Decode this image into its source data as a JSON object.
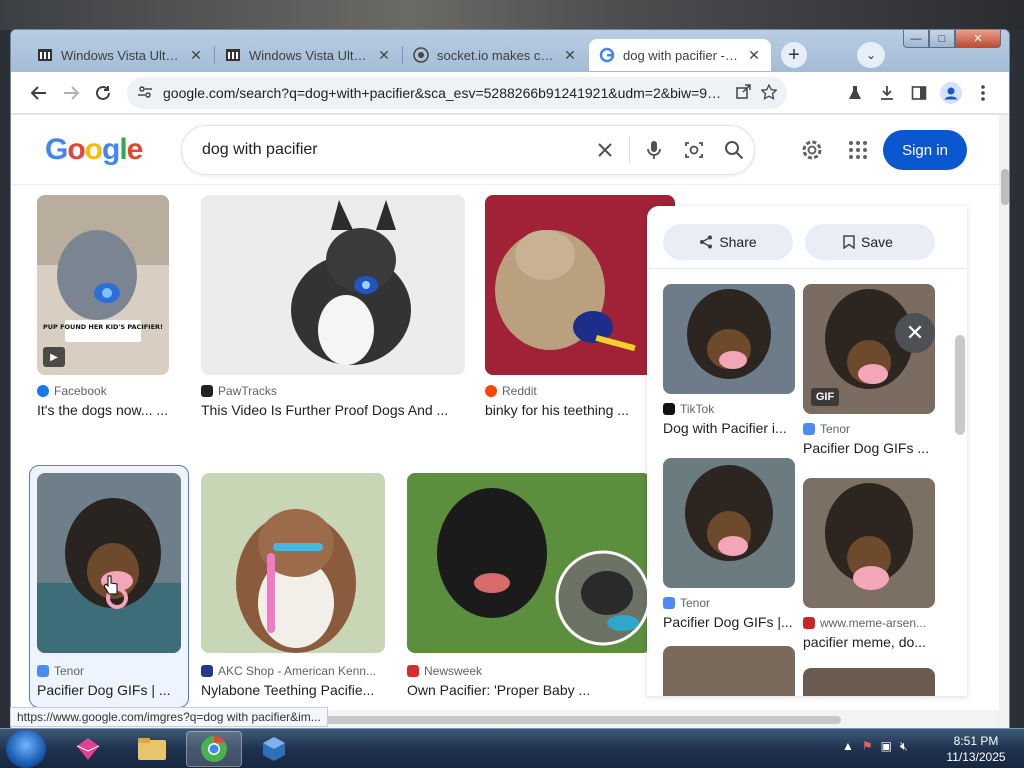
{
  "browser": {
    "tabs": [
      {
        "title": "Windows Vista Ultimat",
        "icon": "museum-icon",
        "active": false
      },
      {
        "title": "Windows Vista Ultimat",
        "icon": "museum-icon",
        "active": false
      },
      {
        "title": "socket.io makes comp",
        "icon": "globe-icon",
        "active": false
      },
      {
        "title": "dog with pacifier - Go",
        "icon": "google-icon",
        "active": true
      }
    ],
    "url": "google.com/search?q=dog+with+pacifier&sca_esv=5288266b91241921&udm=2&biw=988&bih=..."
  },
  "google": {
    "logo": "Google",
    "query": "dog with pacifier",
    "sign_in": "Sign in"
  },
  "results": [
    {
      "source": "Facebook",
      "title": "It's the dogs now... ..."
    },
    {
      "source": "PawTracks",
      "title": "This Video Is Further Proof Dogs And ..."
    },
    {
      "source": "Reddit",
      "title": "binky for his teething ..."
    },
    {
      "source": "Tenor",
      "title": "Pacifier Dog GIFs | ..."
    },
    {
      "source": "AKC Shop - American Kenn...",
      "title": "Nylabone Teething Pacifie..."
    },
    {
      "source": "Newsweek",
      "title": "Own Pacifier: 'Proper Baby ..."
    }
  ],
  "thumb_captions": {
    "facebook_overlay": "PUP FOUND HER KID'S PACIFIER!"
  },
  "panel": {
    "share": "Share",
    "save": "Save",
    "items": [
      {
        "source": "TikTok",
        "title": "Dog with Pacifier i..."
      },
      {
        "source": "Tenor",
        "title": "Pacifier Dog GIFs ...",
        "badge": "GIF"
      },
      {
        "source": "Tenor",
        "title": "Pacifier Dog GIFs |..."
      },
      {
        "source": "www.meme-arsen...",
        "title": "pacifier meme, do..."
      }
    ]
  },
  "status_url": "https://www.google.com/imgres?q=dog with pacifier&im...",
  "taskbar": {
    "time": "8:51 PM",
    "date": "11/13/2025"
  }
}
